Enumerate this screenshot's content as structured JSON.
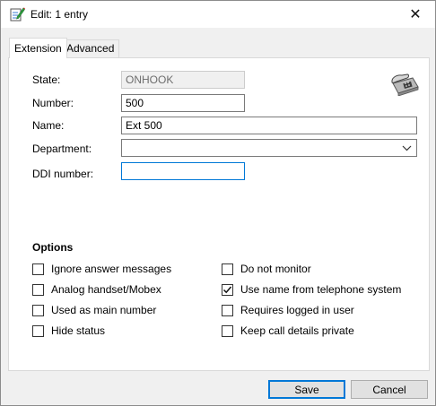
{
  "window": {
    "title": "Edit: 1 entry",
    "close_glyph": "✕"
  },
  "tabs": [
    {
      "label": "Extension",
      "active": true
    },
    {
      "label": "Advanced",
      "active": false
    }
  ],
  "fields": {
    "state": {
      "label": "State:",
      "value": "ONHOOK"
    },
    "number": {
      "label": "Number:",
      "value": "500"
    },
    "name": {
      "label": "Name:",
      "value": "Ext 500"
    },
    "department": {
      "label": "Department:",
      "value": ""
    },
    "ddi": {
      "label": "DDI number:",
      "value": ""
    }
  },
  "options": {
    "title": "Options",
    "left": [
      {
        "label": "Ignore answer messages",
        "checked": false
      },
      {
        "label": "Analog handset/Mobex",
        "checked": false
      },
      {
        "label": "Used as main number",
        "checked": false
      },
      {
        "label": "Hide status",
        "checked": false
      }
    ],
    "right": [
      {
        "label": "Do not monitor",
        "checked": false
      },
      {
        "label": "Use name from telephone system",
        "checked": true
      },
      {
        "label": "Requires logged in user",
        "checked": false
      },
      {
        "label": "Keep call details private",
        "checked": false
      }
    ]
  },
  "buttons": {
    "save": "Save",
    "cancel": "Cancel"
  },
  "icons": {
    "title": "edit-document-icon",
    "phone": "telephone-icon"
  },
  "colors": {
    "focus": "#0078d7",
    "panel": "#ffffff",
    "chrome": "#f0f0f0"
  }
}
